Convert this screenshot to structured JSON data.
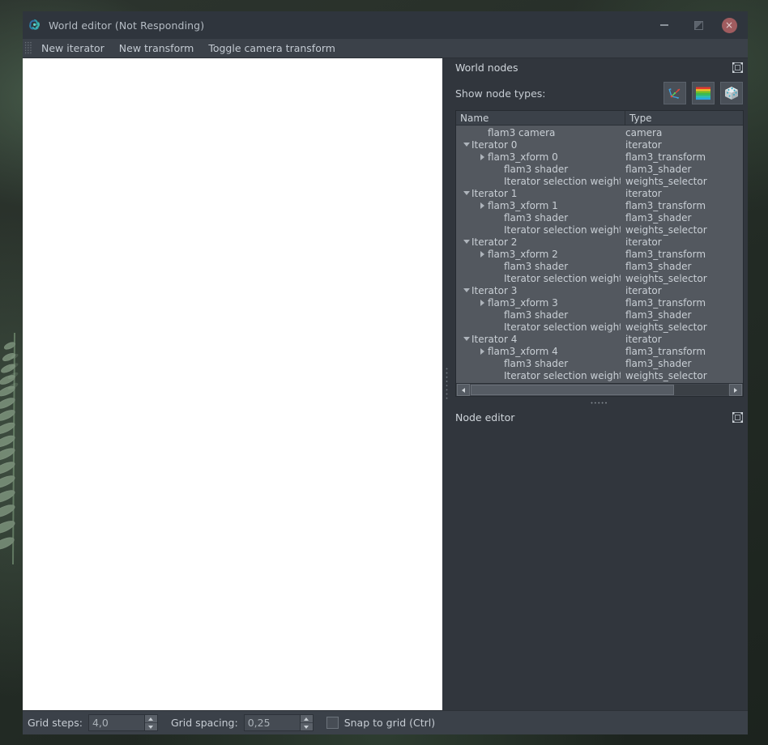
{
  "window": {
    "title": "World editor (Not Responding)",
    "app_icon": "flam3-fractal-icon",
    "buttons": {
      "minimize": "minimize-icon",
      "maximize": "maximize-icon",
      "close": "×"
    }
  },
  "toolbar": {
    "grip": "drag-handle",
    "items": [
      {
        "label": "New iterator"
      },
      {
        "label": "New transform"
      },
      {
        "label": "Toggle camera transform"
      }
    ]
  },
  "world_nodes": {
    "title": "World nodes",
    "float_icon": "float-panel-icon",
    "show_node_types_label": "Show node types:",
    "type_buttons": [
      {
        "name": "transform-gizmo-icon"
      },
      {
        "name": "color-palette-icon"
      },
      {
        "name": "dice-cube-icon"
      }
    ],
    "columns": {
      "name": "Name",
      "type": "Type"
    },
    "rows": [
      {
        "indent": 1,
        "twisty": "none",
        "name": "flam3 camera",
        "type": "camera"
      },
      {
        "indent": 0,
        "twisty": "down",
        "name": "Iterator 0",
        "type": "iterator"
      },
      {
        "indent": 1,
        "twisty": "right",
        "name": "flam3_xform 0",
        "type": "flam3_transform"
      },
      {
        "indent": 2,
        "twisty": "none",
        "name": "flam3 shader",
        "type": "flam3_shader"
      },
      {
        "indent": 2,
        "twisty": "none",
        "name": "Iterator selection weights",
        "type": "weights_selector"
      },
      {
        "indent": 0,
        "twisty": "down",
        "name": "Iterator 1",
        "type": "iterator"
      },
      {
        "indent": 1,
        "twisty": "right",
        "name": "flam3_xform 1",
        "type": "flam3_transform"
      },
      {
        "indent": 2,
        "twisty": "none",
        "name": "flam3 shader",
        "type": "flam3_shader"
      },
      {
        "indent": 2,
        "twisty": "none",
        "name": "Iterator selection weights",
        "type": "weights_selector"
      },
      {
        "indent": 0,
        "twisty": "down",
        "name": "Iterator 2",
        "type": "iterator"
      },
      {
        "indent": 1,
        "twisty": "right",
        "name": "flam3_xform 2",
        "type": "flam3_transform"
      },
      {
        "indent": 2,
        "twisty": "none",
        "name": "flam3 shader",
        "type": "flam3_shader"
      },
      {
        "indent": 2,
        "twisty": "none",
        "name": "Iterator selection weights",
        "type": "weights_selector"
      },
      {
        "indent": 0,
        "twisty": "down",
        "name": "Iterator 3",
        "type": "iterator"
      },
      {
        "indent": 1,
        "twisty": "right",
        "name": "flam3_xform 3",
        "type": "flam3_transform"
      },
      {
        "indent": 2,
        "twisty": "none",
        "name": "flam3 shader",
        "type": "flam3_shader"
      },
      {
        "indent": 2,
        "twisty": "none",
        "name": "Iterator selection weights",
        "type": "weights_selector"
      },
      {
        "indent": 0,
        "twisty": "down",
        "name": "Iterator 4",
        "type": "iterator"
      },
      {
        "indent": 1,
        "twisty": "right",
        "name": "flam3_xform 4",
        "type": "flam3_transform"
      },
      {
        "indent": 2,
        "twisty": "none",
        "name": "flam3 shader",
        "type": "flam3_shader"
      },
      {
        "indent": 2,
        "twisty": "none",
        "name": "Iterator selection weights",
        "type": "weights_selector"
      }
    ]
  },
  "node_editor": {
    "title": "Node editor",
    "float_icon": "float-panel-icon"
  },
  "statusbar": {
    "grid_steps_label": "Grid steps:",
    "grid_steps_value": "4,0",
    "grid_spacing_label": "Grid spacing:",
    "grid_spacing_value": "0,25",
    "snap_label": "Snap to grid (Ctrl)",
    "snap_checked": false
  },
  "colors": {
    "window_bg": "#31363d",
    "titlebar_bg": "#2f353d",
    "toolbar_bg": "#3b4149",
    "tree_bg": "#53585f",
    "canvas_bg": "#ffffff",
    "close_button": "#a05c5f",
    "text": "#c9cfd5"
  }
}
